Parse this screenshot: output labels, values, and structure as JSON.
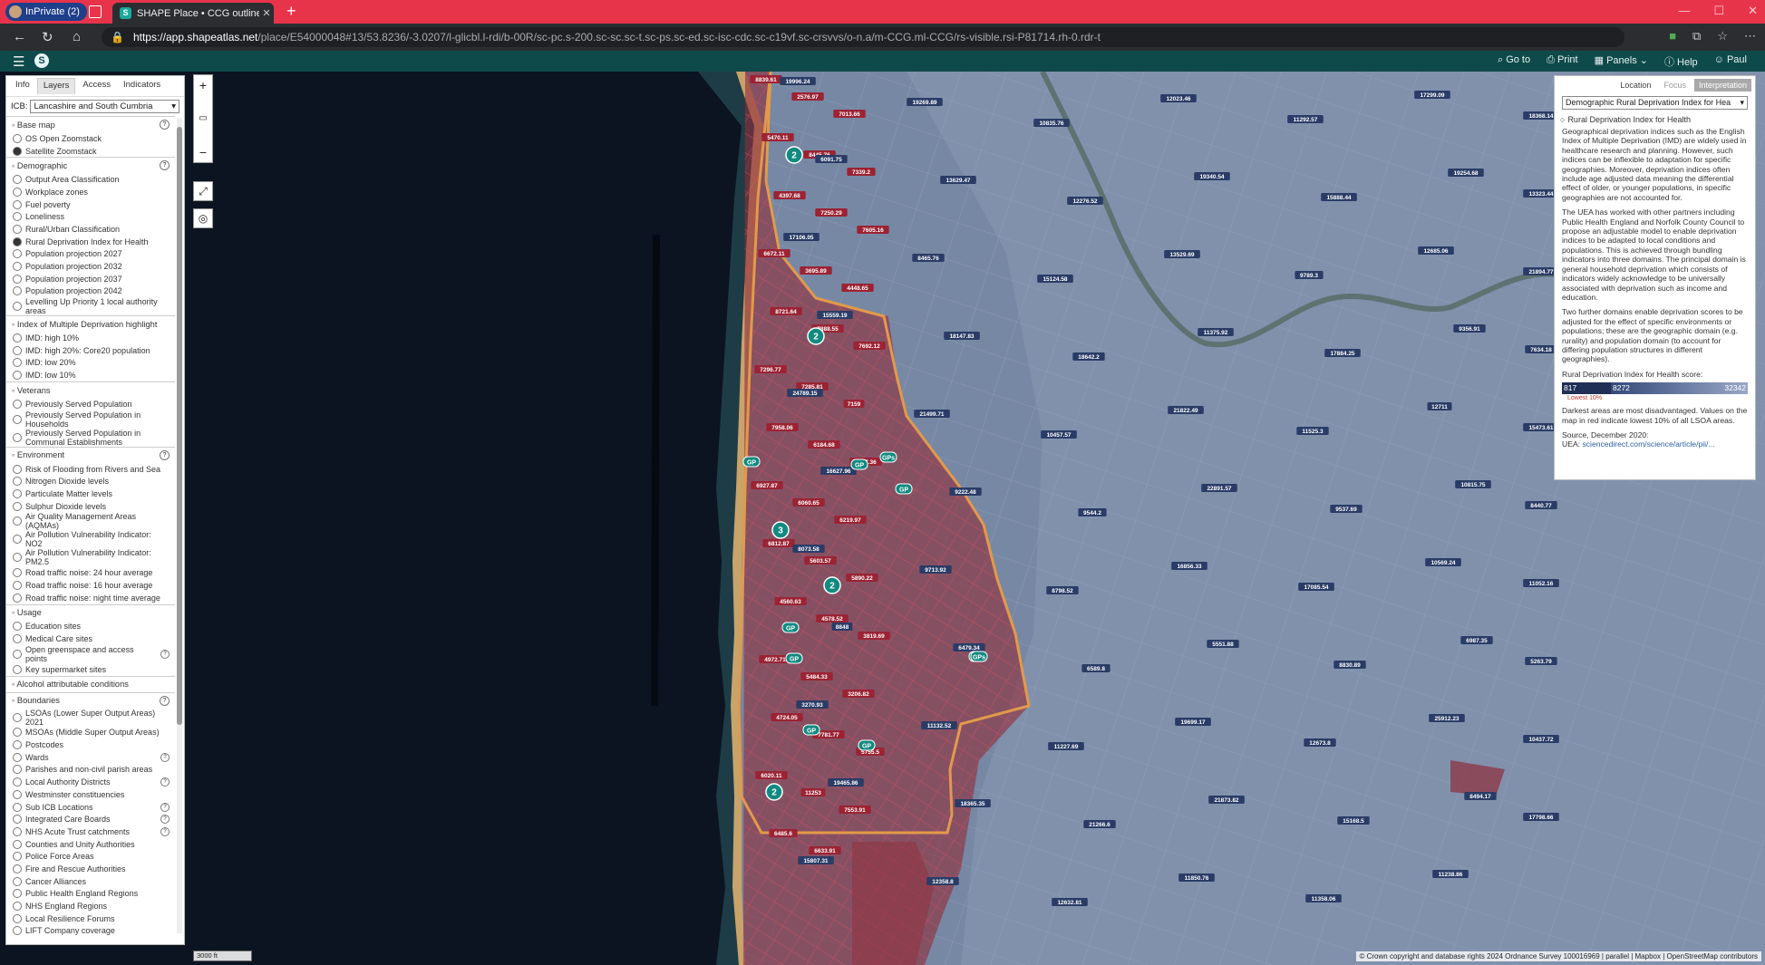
{
  "browser": {
    "inprivate": "InPrivate (2)",
    "tab_title": "SHAPE Place • CCG outline for GI",
    "url_host": "https://app.shapeatlas.net",
    "url_path": "/place/E54000048#13/53.8236/-3.0207/l-glicbl.l-rdi/b-00R/sc-pc.s-200.sc-sc.sc-t.sc-ps.sc-ed.sc-isc-cdc.sc-c19vf.sc-crsvvs/o-n.a/m-CCG.ml-CCG/rs-visible.rsi-P81714.rh-0.rdr-t"
  },
  "appbar": {
    "goto": "Go to",
    "print": "Print",
    "panels": "Panels",
    "help": "Help",
    "user": "Paul"
  },
  "left_panel": {
    "tabs": [
      "Info",
      "Layers",
      "Access",
      "Indicators"
    ],
    "icb_label": "ICB:",
    "icb_value": "Lancashire and South Cumbria",
    "sections": [
      {
        "title": "Base map",
        "help": true,
        "items": [
          {
            "label": "OS Open Zoomstack"
          },
          {
            "label": "Satellite Zoomstack",
            "on": true
          }
        ]
      },
      {
        "title": "Demographic",
        "help": true,
        "items": [
          {
            "label": "Output Area Classification"
          },
          {
            "label": "Workplace zones"
          },
          {
            "label": "Fuel poverty"
          },
          {
            "label": "Loneliness"
          },
          {
            "label": "Rural/Urban Classification"
          },
          {
            "label": "Rural Deprivation Index for Health",
            "on": true
          },
          {
            "label": "Population projection 2027"
          },
          {
            "label": "Population projection 2032"
          },
          {
            "label": "Population projection 2037"
          },
          {
            "label": "Population projection 2042"
          },
          {
            "label": "Levelling Up Priority 1 local authority areas"
          }
        ]
      },
      {
        "title": "Index of Multiple Deprivation highlight",
        "items": [
          {
            "label": "IMD: high 10%"
          },
          {
            "label": "IMD: high 20%: Core20 population"
          },
          {
            "label": "IMD: low 20%"
          },
          {
            "label": "IMD: low 10%"
          }
        ]
      },
      {
        "title": "Veterans",
        "items": [
          {
            "label": "Previously Served Population"
          },
          {
            "label": "Previously Served Population in Households"
          },
          {
            "label": "Previously Served Population in Communal Establishments"
          }
        ]
      },
      {
        "title": "Environment",
        "help": true,
        "items": [
          {
            "label": "Risk of Flooding from Rivers and Sea"
          },
          {
            "label": "Nitrogen Dioxide levels"
          },
          {
            "label": "Particulate Matter levels"
          },
          {
            "label": "Sulphur Dioxide levels"
          },
          {
            "label": "Air Quality Management Areas (AQMAs)"
          },
          {
            "label": "Air Pollution Vulnerability Indicator: NO2"
          },
          {
            "label": "Air Pollution Vulnerability Indicator: PM2.5"
          },
          {
            "label": "Road traffic noise: 24 hour average"
          },
          {
            "label": "Road traffic noise: 16 hour average"
          },
          {
            "label": "Road traffic noise: night time average"
          }
        ]
      },
      {
        "title": "Usage",
        "items": [
          {
            "label": "Education sites"
          },
          {
            "label": "Medical Care sites"
          },
          {
            "label": "Open greenspace and access points",
            "help": true
          },
          {
            "label": "Key supermarket sites"
          }
        ]
      },
      {
        "title": "Alcohol attributable conditions",
        "items": []
      },
      {
        "title": "Boundaries",
        "help": true,
        "items": [
          {
            "label": "LSOAs (Lower Super Output Areas) 2021"
          },
          {
            "label": "MSOAs (Middle Super Output Areas)"
          },
          {
            "label": "Postcodes"
          },
          {
            "label": "Wards",
            "help": true
          },
          {
            "label": "Parishes and non-civil parish areas"
          },
          {
            "label": "Local Authority Districts",
            "help": true
          },
          {
            "label": "Westminster constituencies"
          },
          {
            "label": "Sub ICB Locations",
            "help": true
          },
          {
            "label": "Integrated Care Boards",
            "help": true
          },
          {
            "label": "NHS Acute Trust catchments",
            "help": true
          },
          {
            "label": "Counties and Unity Authorities"
          },
          {
            "label": "Police Force Areas"
          },
          {
            "label": "Fire and Rescue Authorities"
          },
          {
            "label": "Cancer Alliances"
          },
          {
            "label": "Public Health England Regions"
          },
          {
            "label": "NHS England Regions"
          },
          {
            "label": "Local Resilience Forums"
          },
          {
            "label": "LIFT Company coverage"
          }
        ]
      }
    ]
  },
  "right_panel": {
    "tabs": [
      "Location",
      "Focus",
      "Interpretation"
    ],
    "select": "Demographic Rural Deprivation Index for Hea",
    "heading": "Rural Deprivation Index for Health",
    "p1": "Geographical deprivation indices such as the English Index of Multiple Deprivation (IMD) are widely used in healthcare research and planning. However, such indices can be inflexible to adaptation for specific geographies. Moreover, deprivation indices often include age adjusted data meaning the differential effect of older, or younger populations, in specific geographies are not accounted for.",
    "p2": "The UEA has worked with other partners including Public Health England and Norfolk County Council to propose an adjustable model to enable deprivation indices to be adapted to local conditions and populations. This is achieved through bundling indicators into three domains. The principal domain is general household deprivation which consists of indicators widely acknowledge to be universally associated with deprivation such as income and education.",
    "p3": "Two further domains enable deprivation scores to be adjusted for the effect of specific environments or populations; these are the geographic domain (e.g. rurality) and population domain (to account for differing population structures in different geographies).",
    "score_label": "Rural Deprivation Index for Health score:",
    "legend_min": "817",
    "legend_mid": "8272",
    "legend_max": "32342",
    "lowest": "Lowest 10%",
    "p4": "Darkest areas are most disadvantaged. Values on the map in red indicate lowest 10% of all LSOA areas.",
    "source": "Source, December 2020:",
    "uea_label": "UEA:",
    "uea_link": "sciencedirect.com/science/article/pii/..."
  },
  "map": {
    "scale": "3000 ft",
    "attribution": "© Crown copyright and database rights 2024 Ordnance Survey 100016969 | parallel | Mapbox | OpenStreetMap contributors",
    "labels_red": [
      "8839.61",
      "2576.97",
      "7013.66",
      "5470.11",
      "8445.76",
      "7339.2",
      "4397.68",
      "7250.29",
      "7605.16",
      "6672.11",
      "3695.89",
      "4448.65",
      "8721.64",
      "7888.55",
      "7692.12",
      "7296.77",
      "7285.81",
      "7159",
      "7958.06",
      "6184.68",
      "7067.36",
      "6927.87",
      "6060.65",
      "6219.97",
      "6812.87",
      "5603.57",
      "5890.22",
      "4560.63",
      "4578.52",
      "3819.69",
      "4972.71",
      "5484.33",
      "3206.82",
      "4724.05",
      "7781.77",
      "5755.5",
      "6020.11",
      "11253",
      "7553.91",
      "6485.6",
      "6633.91"
    ],
    "labels_blue": [
      "19996.24",
      "19269.89",
      "10835.76",
      "12023.46",
      "11292.57",
      "17299.09",
      "18368.14",
      "6091.75",
      "13629.47",
      "12276.52",
      "19340.54",
      "15888.44",
      "19254.68",
      "13323.44",
      "17106.05",
      "8465.76",
      "15124.58",
      "13529.69",
      "9789.3",
      "12685.06",
      "21894.77",
      "15559.19",
      "18147.83",
      "18642.2",
      "11375.92",
      "17884.25",
      "9356.91",
      "7634.18",
      "24789.15",
      "21499.71",
      "10457.57",
      "21822.49",
      "11525.3",
      "12711",
      "15473.61",
      "16627.96",
      "9222.48",
      "9544.2",
      "22891.57",
      "9537.69",
      "10815.75",
      "8440.77",
      "8073.58",
      "9713.92",
      "8798.52",
      "16856.33",
      "17085.54",
      "10569.24",
      "11052.16",
      "8848",
      "6479.34",
      "6589.8",
      "5551.88",
      "8830.89",
      "6987.35",
      "5263.79",
      "3270.93",
      "11132.52",
      "11227.69",
      "19699.17",
      "12673.8",
      "25912.23",
      "10437.72",
      "19465.86",
      "18365.35",
      "21266.6",
      "21873.82",
      "15168.5",
      "8494.17",
      "17798.66",
      "15807.31",
      "12358.8",
      "12632.81",
      "11850.76",
      "11358.06",
      "11238.86"
    ],
    "badges_num": [
      "2",
      "2",
      "3",
      "2",
      "2"
    ],
    "badges_gp": [
      "GP",
      "GP",
      "GPs",
      "GP",
      "GP",
      "GP",
      "GP",
      "GP",
      "GP",
      "GPs"
    ]
  },
  "colors": {
    "sea": "#0b1420",
    "land": "#7f8ea8",
    "deprived": "#8f2d3b",
    "boundary": "#e29a4a",
    "appbar": "#0f4a4a",
    "titlebar": "#e8344b"
  }
}
